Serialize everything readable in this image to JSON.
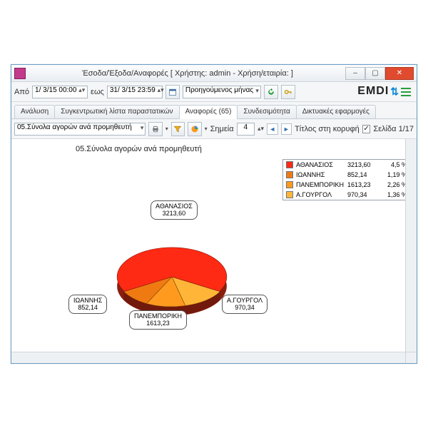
{
  "window": {
    "title": "Έσοδα/Έξοδα/Αναφορές   [ Χρήστης: admin - Χρήση/εταιρία:                     ]"
  },
  "brand": "EMDI",
  "daterow": {
    "from_label": "Από",
    "from_value": "1/ 3/15 00:00",
    "to_label": "εως",
    "to_value": "31/ 3/15 23:59",
    "period_selected": "Προηγούμενος μήνας"
  },
  "tabs": [
    {
      "label": "Ανάλυση"
    },
    {
      "label": "Συγκεντρωτική λίστα παραστατικών"
    },
    {
      "label": "Αναφορές (65)"
    },
    {
      "label": "Συνδεσιμότητα"
    },
    {
      "label": "Δικτυακές εφαρμογές"
    }
  ],
  "active_tab_index": 2,
  "report_bar": {
    "report_selected": "05.Σύνολα αγορών ανά προμηθευτή",
    "points_label": "Σημεία",
    "points_value": "4",
    "title_on_top_label": "Τίτλος στη κορυφή",
    "title_on_top_checked": true,
    "page_label": "Σελίδα 1/17"
  },
  "report_title": "05.Σύνολα αγορών ανά προμηθευτή",
  "chart_data": {
    "type": "pie",
    "title": "05.Σύνολα αγορών ανά προμηθευτή",
    "series": [
      {
        "name": "ΑΘΑΝΑΣΙΟΣ",
        "value": 3213.6,
        "value_str": "3213,60",
        "pct": 4.5,
        "pct_str": "4,5 %",
        "color": "#ff2a14"
      },
      {
        "name": "ΙΩΑΝΝΗΣ",
        "value": 852.14,
        "value_str": "852,14",
        "pct": 1.19,
        "pct_str": "1,19 %",
        "color": "#f07a12"
      },
      {
        "name": "ΠΑΝΕΜΠΟΡΙΚΗ",
        "value": 1613.23,
        "value_str": "1613,23",
        "pct": 2.26,
        "pct_str": "2,26 %",
        "color": "#ff9a1f"
      },
      {
        "name": "Α.ΓΟΥΡΓΟΛ",
        "value": 970.34,
        "value_str": "970,34",
        "pct": 1.36,
        "pct_str": "1,36 %",
        "color": "#ffb638"
      }
    ],
    "legend_position": "right",
    "callout_labels": [
      {
        "name": "ΑΘΑΝΑΣΙΟΣ",
        "value": "3213,60"
      },
      {
        "name": "ΙΩΑΝΝΗΣ",
        "value": "852,14"
      },
      {
        "name": "ΠΑΝΕΜΠΟΡΙΚΗ",
        "value": "1613,23"
      },
      {
        "name": "Α.ΓΟΥΡΓΟΛ",
        "value": "970,34"
      }
    ]
  }
}
